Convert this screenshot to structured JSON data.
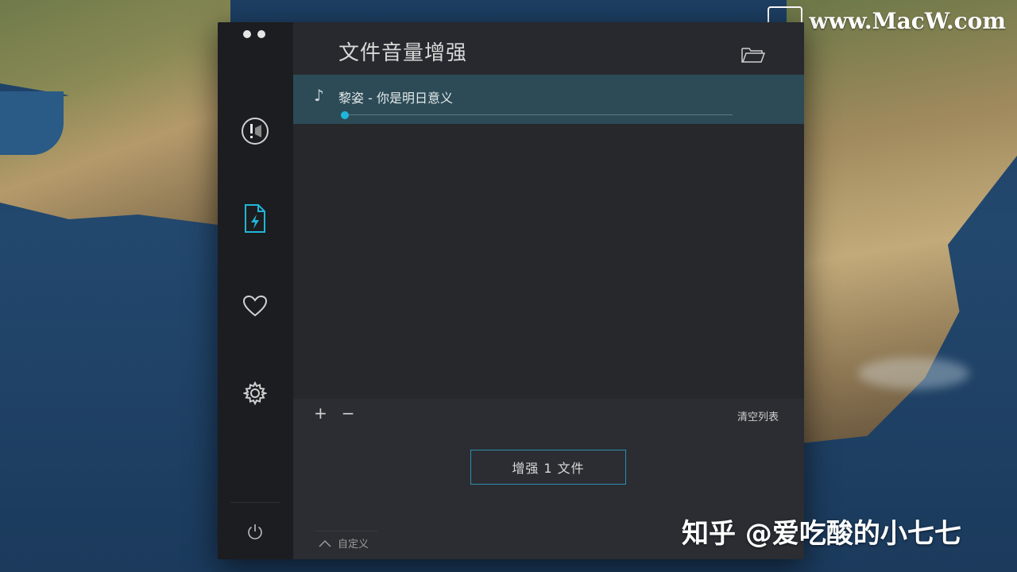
{
  "watermarks": {
    "top": "www.MacW.com",
    "bottom": "知乎 @爱吃酸的小七七"
  },
  "window": {
    "title": "文件音量增强",
    "sidebar": {
      "items": [
        {
          "icon": "alert-speaker-icon"
        },
        {
          "icon": "file-lightning-icon",
          "active": true
        },
        {
          "icon": "heart-icon"
        },
        {
          "icon": "gear-icon"
        }
      ],
      "power_icon": "power-icon"
    },
    "tracks": [
      {
        "name": "黎姿 - 你是明日意义",
        "progress": 0
      }
    ],
    "controls": {
      "add": "+",
      "remove": "−",
      "clear_label": "清空列表"
    },
    "enhance_button": "增强 1 文件",
    "custom_label": "自定义",
    "accent": "#1fb6d9",
    "row_highlight": "#2c4b56"
  }
}
